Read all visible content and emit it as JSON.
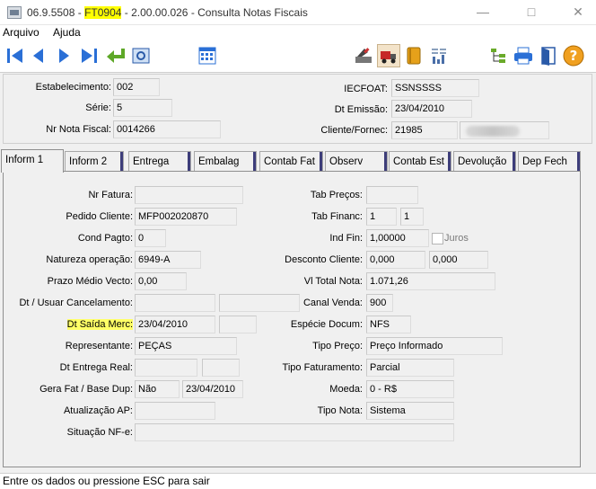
{
  "window": {
    "title_prefix": "06.9.5508 - ",
    "title_highlight": "FT0904",
    "title_suffix": " - 2.00.00.026 - Consulta Notas Fiscais",
    "minimize": "—",
    "maximize": "□",
    "close": "✕"
  },
  "menu": {
    "items": [
      "Arquivo",
      "Ajuda"
    ]
  },
  "toolbar": {
    "left_icons": [
      "first-record-icon",
      "previous-record-icon",
      "next-record-icon",
      "last-record-icon",
      "return-icon",
      "preview-icon",
      "calendar-grid-icon"
    ],
    "right_icons": [
      "edit-document-icon",
      "truck-icon",
      "book-icon",
      "report-chart-icon",
      "tree-icon",
      "printer-icon",
      "exit-door-icon",
      "help-icon"
    ]
  },
  "header": {
    "estabelecimento": {
      "label": "Estabelecimento:",
      "value": "002"
    },
    "serie": {
      "label": "Série:",
      "value": "5"
    },
    "nr_nota": {
      "label": "Nr Nota Fiscal:",
      "value": "0014266"
    },
    "iecfoat": {
      "label": "IECFOAT:",
      "value": "SSNSSSS"
    },
    "dt_emissao": {
      "label": "Dt Emissão:",
      "value": "23/04/2010"
    },
    "cliente": {
      "label": "Cliente/Fornec:",
      "value": "21985"
    }
  },
  "tabs": [
    "Inform 1",
    "Inform 2",
    "Entrega",
    "Embalag",
    "Contab Fat",
    "Observ",
    "Contab Est",
    "Devolução",
    "Dep Fech"
  ],
  "form": {
    "nr_fatura": {
      "label": "Nr Fatura:",
      "value": ""
    },
    "pedido_cliente": {
      "label": "Pedido Cliente:",
      "value": "MFP002020870"
    },
    "cond_pagto": {
      "label": "Cond Pagto:",
      "value": "0"
    },
    "natureza": {
      "label": "Natureza operação:",
      "value": "6949-A"
    },
    "prazo_medio": {
      "label": "Prazo Médio Vecto:",
      "value": "0,00"
    },
    "dt_cancel": {
      "label": "Dt / Usuar Cancelamento:",
      "value1": "",
      "value2": ""
    },
    "dt_saida": {
      "label": "Dt Saída Merc:",
      "value1": "23/04/2010",
      "value2": ""
    },
    "representante": {
      "label": "Representante:",
      "value": "PEÇAS"
    },
    "dt_entrega": {
      "label": "Dt Entrega Real:",
      "value1": "",
      "value2": ""
    },
    "gera_fat": {
      "label": "Gera Fat / Base Dup:",
      "value1": "Não",
      "value2": "23/04/2010"
    },
    "atualizacao_ap": {
      "label": "Atualização AP:",
      "value": ""
    },
    "situacao_nfe": {
      "label": "Situação NF-e:",
      "value": ""
    },
    "tab_precos": {
      "label": "Tab Preços:",
      "value": ""
    },
    "tab_financ": {
      "label": "Tab Financ:",
      "value1": "1",
      "value2": "1"
    },
    "ind_fin": {
      "label": "Ind Fin:",
      "value": "1,00000",
      "juros": "Juros"
    },
    "desconto": {
      "label": "Desconto Cliente:",
      "value1": "0,000",
      "value2": "0,000"
    },
    "vl_total": {
      "label": "Vl Total Nota:",
      "value": "1.071,26"
    },
    "canal_venda": {
      "label": "Canal Venda:",
      "value": "900"
    },
    "especie": {
      "label": "Espécie Docum:",
      "value": "NFS"
    },
    "tipo_preco": {
      "label": "Tipo Preço:",
      "value": "Preço Informado"
    },
    "tipo_faturamento": {
      "label": "Tipo Faturamento:",
      "value": "Parcial"
    },
    "moeda": {
      "label": "Moeda:",
      "value": "0 - R$"
    },
    "tipo_nota": {
      "label": "Tipo Nota:",
      "value": "Sistema"
    }
  },
  "status": {
    "text": "Entre os dados ou pressione ESC para sair"
  },
  "colors": {
    "highlight": "#ffff00",
    "toolbar_blue": "#2a6fd6",
    "return_green": "#5ea828"
  }
}
